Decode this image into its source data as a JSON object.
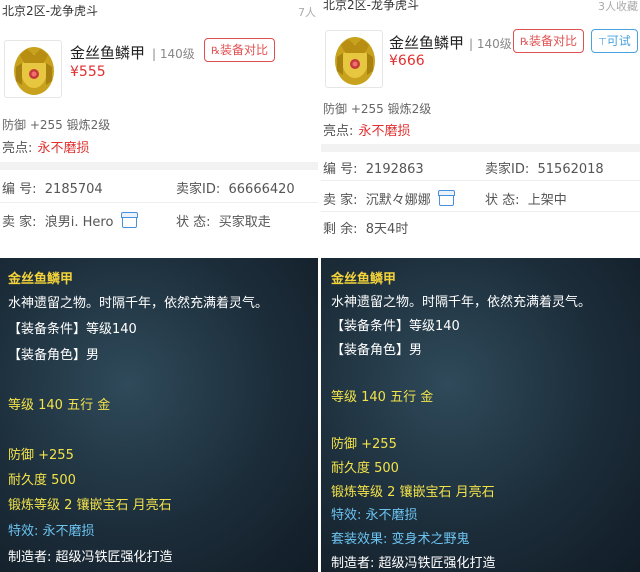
{
  "left": {
    "server": "北京2区-龙争虎斗",
    "watch": "7人",
    "item_name": "金丝鱼鳞甲",
    "level": "140级",
    "compare_btn": "装备对比",
    "price": "¥555",
    "attr": "防御 +255 锻炼2级",
    "highlight_label": "亮点:",
    "highlight_value": "永不磨损",
    "id_label": "编 号:",
    "id_value": "2185704",
    "seller_id_label": "卖家ID:",
    "seller_id_value": "66666420",
    "seller_label": "卖 家:",
    "seller_value": "浪男i. Hero",
    "status_label": "状 态:",
    "status_value": "买家取走",
    "tooltip": {
      "title": "金丝鱼鳞甲",
      "desc": "水神遗留之物。时隔千年，依然充满着灵气。",
      "req_level": "【装备条件】等级140",
      "req_role": "【装备角色】男",
      "grade": "等级 140 五行 金",
      "defense": "防御 +255",
      "durability": "耐久度 500",
      "forge": "锻炼等级 2 镶嵌宝石 月亮石",
      "special": "特效: 永不磨损",
      "maker": "制造者: 超级冯铁匠强化打造"
    }
  },
  "right": {
    "server": "北京2区-龙争虎斗",
    "watch": "3人收藏",
    "item_name": "金丝鱼鳞甲",
    "level": "140级",
    "compare_btn": "装备对比",
    "try_btn": "可试",
    "price": "¥666",
    "attr": "防御 +255 锻炼2级",
    "highlight_label": "亮点:",
    "highlight_value": "永不磨损",
    "id_label": "编 号:",
    "id_value": "2192863",
    "seller_id_label": "卖家ID:",
    "seller_id_value": "51562018",
    "seller_label": "卖 家:",
    "seller_value": "沉默々娜娜",
    "status_label": "状 态:",
    "status_value": "上架中",
    "remain_label": "剩 余:",
    "remain_value": "8天4时",
    "tooltip": {
      "title": "金丝鱼鳞甲",
      "desc": "水神遗留之物。时隔千年，依然充满着灵气。",
      "req_level": "【装备条件】等级140",
      "req_role": "【装备角色】男",
      "grade": "等级 140 五行 金",
      "defense": "防御 +255",
      "durability": "耐久度 500",
      "forge": "锻炼等级 2 镶嵌宝石 月亮石",
      "special": "特效: 永不磨损",
      "set_effect": "套装效果: 变身术之野鬼",
      "maker": "制造者: 超级冯铁匠强化打造"
    }
  }
}
